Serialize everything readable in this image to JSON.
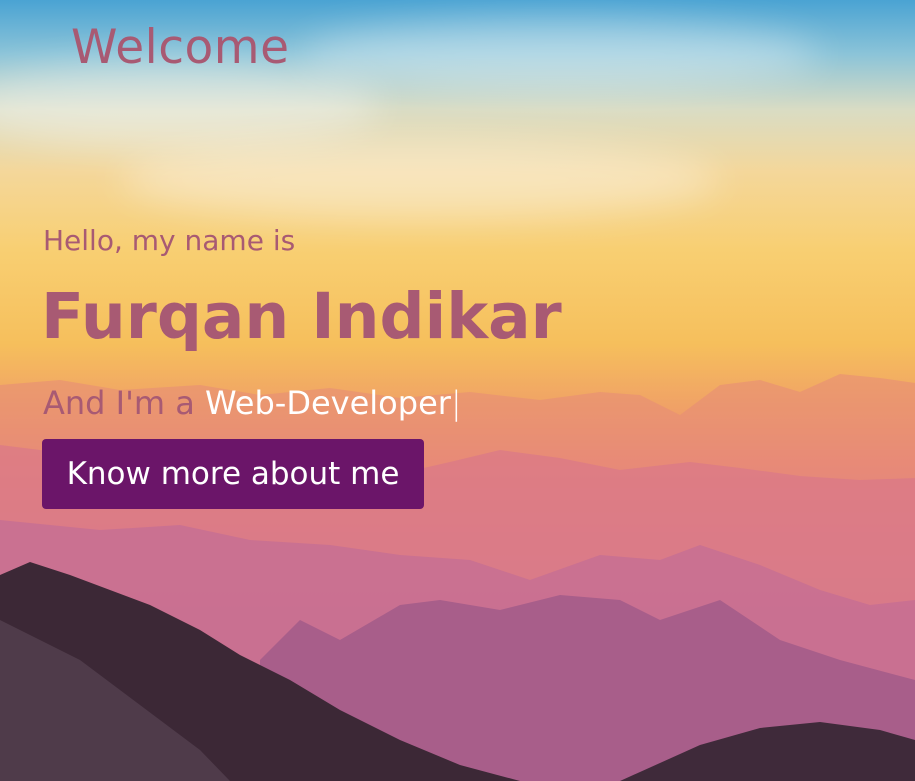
{
  "header": {
    "title": "Welcome"
  },
  "hero": {
    "greeting": "Hello, my name is",
    "name": "Furqan Indikar",
    "role_prefix": "And I'm a",
    "role_word": "Web-Developer",
    "cursor": "|",
    "cta_label": "Know more about me"
  },
  "colors": {
    "accent_text": "#a85a73",
    "button_bg": "#6b1569",
    "button_text": "#ffffff"
  }
}
